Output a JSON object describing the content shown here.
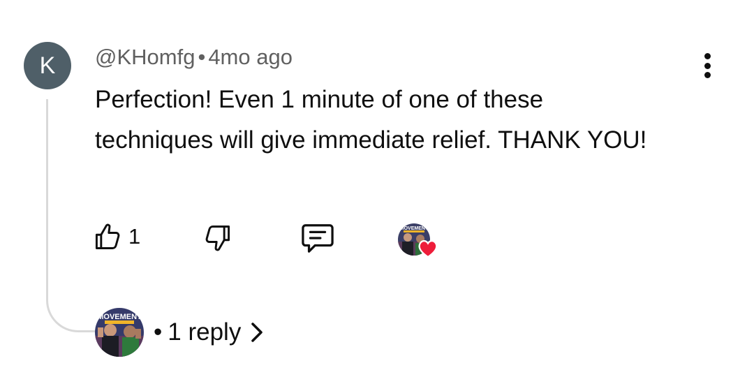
{
  "comment": {
    "avatar_letter": "K",
    "username": "@KHomfg",
    "separator": "•",
    "age": "4mo ago",
    "text": "Perfection! Even 1 minute of one of these techniques will give immediate relief. THANK YOU!"
  },
  "actions": {
    "like_icon": "thumbs-up-icon",
    "like_count": "1",
    "dislike_icon": "thumbs-down-icon",
    "reply_icon": "comment-icon",
    "creator_heart_icon": "heart-icon"
  },
  "replies": {
    "separator": "•",
    "label": "1 reply",
    "chevron_icon": "chevron-right-icon"
  },
  "creator_logo_text": "MOVEMENT",
  "colors": {
    "avatar_bg": "#4f5f68",
    "heart": "#ee1d3a",
    "meta_text": "#606060",
    "thread_line": "#d9d9d9"
  }
}
